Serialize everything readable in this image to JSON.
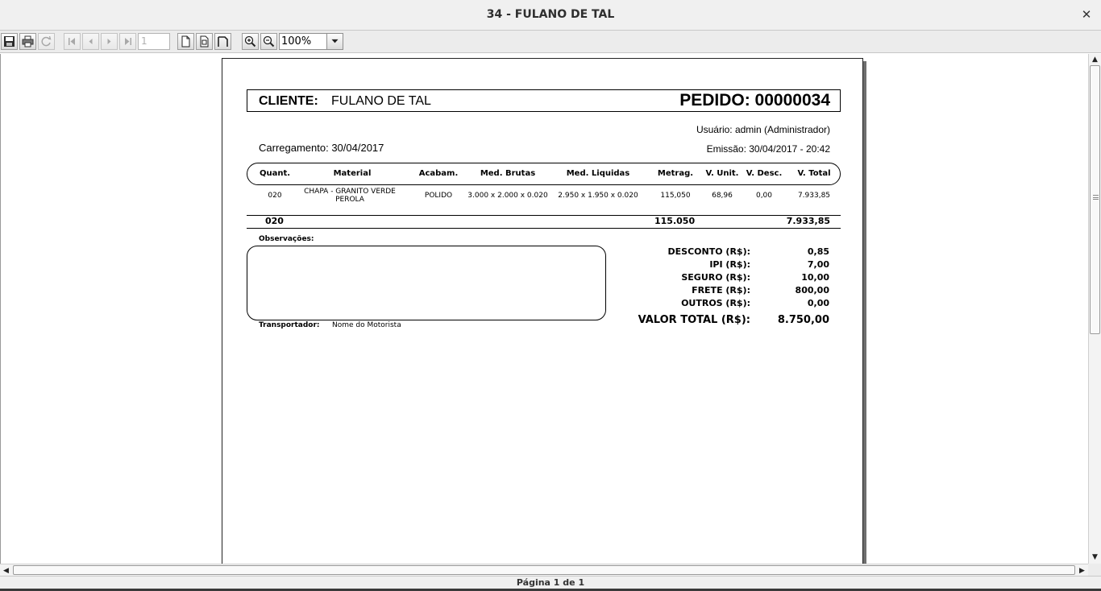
{
  "window": {
    "title": "34 - FULANO DE TAL",
    "close_icon": "close-icon"
  },
  "toolbar": {
    "icons": [
      "save-icon",
      "print-icon",
      "reload-icon",
      "first-page-icon",
      "previous-page-icon",
      "next-page-icon",
      "last-page-icon",
      "actual-size-icon",
      "fit-page-icon",
      "fit-width-icon",
      "zoom-in-icon",
      "zoom-out-icon",
      "chevron-down-icon"
    ],
    "page_number": "1",
    "zoom": "100%"
  },
  "report": {
    "cliente_label": "CLIENTE:",
    "cliente_name": "FULANO DE TAL",
    "pedido": "PEDIDO: 00000034",
    "usuario": "Usuário: admin (Administrador)",
    "carregamento": "Carregamento: 30/04/2017",
    "emissao": "Emissão: 30/04/2017 - 20:42",
    "columns": [
      "Quant.",
      "Material",
      "Acabam.",
      "Med. Brutas",
      "Med. Liquidas",
      "Metrag.",
      "V. Unit.",
      "V. Desc.",
      "V. Total"
    ],
    "rows": [
      {
        "quant": "020",
        "material": "CHAPA - GRANITO VERDE PEROLA",
        "acabam": "POLIDO",
        "med_brutas": "3.000 x 2.000 x 0.020",
        "med_liquidas": "2.950 x 1.950 x 0.020",
        "metrag": "115,050",
        "v_unit": "68,96",
        "v_desc": "0,00",
        "v_total": "7.933,85"
      }
    ],
    "totals": {
      "quant": "020",
      "metrag": "115.050",
      "v_total": "7.933,85"
    },
    "observacoes_label": "Observações:",
    "observacoes": "",
    "transportador_label": "Transportador:",
    "transportador": "Nome do Motorista",
    "summary": [
      {
        "label": "DESCONTO (R$):",
        "value": "0,85"
      },
      {
        "label": "IPI (R$):",
        "value": "7,00"
      },
      {
        "label": "SEGURO (R$):",
        "value": "10,00"
      },
      {
        "label": "FRETE (R$):",
        "value": "800,00"
      },
      {
        "label": "OUTROS (R$):",
        "value": "0,00"
      }
    ],
    "valor_total_label": "VALOR TOTAL (R$):",
    "valor_total": "8.750,00"
  },
  "status": {
    "page_indicator": "Página 1 de 1"
  }
}
